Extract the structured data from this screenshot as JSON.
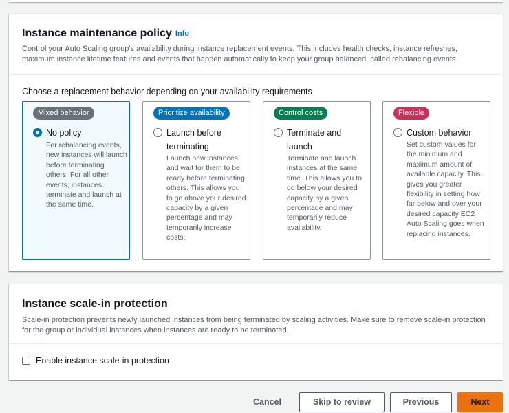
{
  "colors": {
    "accent": "#0073bb",
    "primary_button": "#ec7211",
    "badge_mixed": "#687078",
    "badge_prioritize": "#0073bb",
    "badge_cost": "#037f51",
    "badge_flexible": "#c7315a"
  },
  "maintenance": {
    "title": "Instance maintenance policy",
    "info": "Info",
    "description": "Control your Auto Scaling group's availability during instance replacement events. This includes health checks, instance refreshes, maximum instance lifetime features and events that happen automatically to keep your group balanced, called rebalancing events.",
    "question": "Choose a replacement behavior depending on your availability requirements",
    "options": [
      {
        "badge": "Mixed behavior",
        "title": "No policy",
        "description": "For rebalancing events, new instances will launch before terminating others. For all other events, instances terminate and launch at the same time.",
        "selected": true
      },
      {
        "badge": "Prioritize availability",
        "title": "Launch before terminating",
        "description": "Launch new instances and wait for them to be ready before terminating others. This allows you to go above your desired capacity by a given percentage and may temporarily increase costs.",
        "selected": false
      },
      {
        "badge": "Control costs",
        "title": "Terminate and launch",
        "description": "Terminate and launch instances at the same time. This allows you to go below your desired capacity by a given percentage and may temporarily reduce availability.",
        "selected": false
      },
      {
        "badge": "Flexible",
        "title": "Custom behavior",
        "description": "Set custom values for the minimum and maximum amount of available capacity. This gives you greater flexibility in setting how far below and over your desired capacity EC2 Auto Scaling goes when replacing instances.",
        "selected": false
      }
    ]
  },
  "scale_in": {
    "title": "Instance scale-in protection",
    "description": "Scale-in protection prevents newly launched instances from being terminated by scaling activities. Make sure to remove scale-in protection for the group or individual instances when instances are ready to be terminated.",
    "checkbox_label": "Enable instance scale-in protection",
    "checked": false
  },
  "actions": {
    "cancel": "Cancel",
    "skip": "Skip to review",
    "previous": "Previous",
    "next": "Next"
  }
}
